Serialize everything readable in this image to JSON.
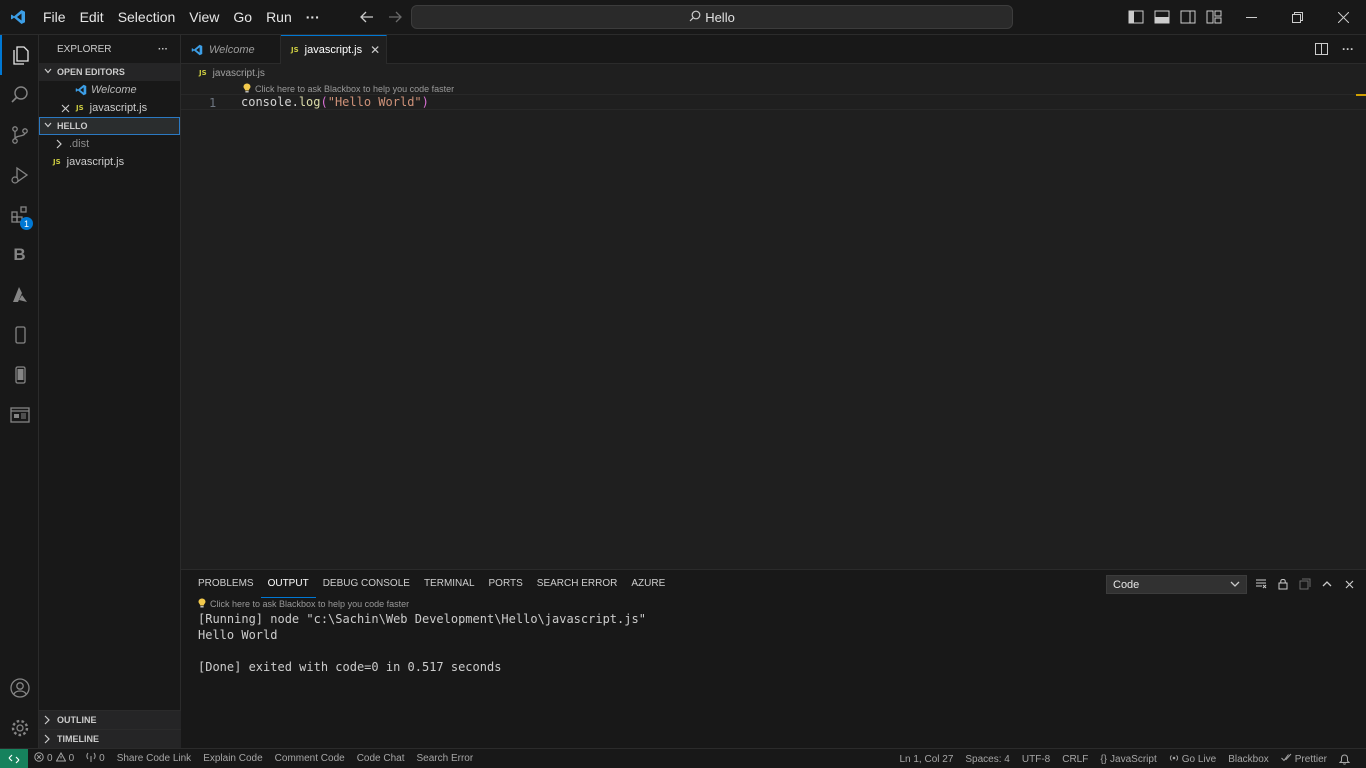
{
  "menu": {
    "items": [
      "File",
      "Edit",
      "Selection",
      "View",
      "Go",
      "Run"
    ],
    "more": "···"
  },
  "command_center": {
    "text": "Hello"
  },
  "sidebar": {
    "title": "EXPLORER",
    "more": "···",
    "open_editors_label": "OPEN EDITORS",
    "open_editors": [
      {
        "name": "Welcome"
      },
      {
        "name": "javascript.js",
        "badge": "JS"
      }
    ],
    "folder_label": "HELLO",
    "folder_items": [
      {
        "name": ".dist"
      },
      {
        "name": "javascript.js",
        "badge": "JS"
      }
    ],
    "outline_label": "OUTLINE",
    "timeline_label": "TIMELINE"
  },
  "activity": {
    "extensions_badge": "1",
    "blackbox_letter": "B"
  },
  "tabs": [
    {
      "label": "Welcome"
    },
    {
      "label": "javascript.js",
      "badge": "JS"
    }
  ],
  "breadcrumb": {
    "badge": "JS",
    "file": "javascript.js"
  },
  "editor": {
    "codelens": "Click here to ask Blackbox to help you code faster",
    "line_number": "1",
    "code": {
      "obj": "console",
      "dot": ".",
      "fn": "log",
      "open": "(",
      "str": "\"Hello World\"",
      "close": ")"
    }
  },
  "panel": {
    "tabs": [
      "PROBLEMS",
      "OUTPUT",
      "DEBUG CONSOLE",
      "TERMINAL",
      "PORTS",
      "SEARCH ERROR",
      "AZURE"
    ],
    "active_tab": "OUTPUT",
    "select_value": "Code",
    "hint": "Click here to ask Blackbox to help you code faster",
    "output_lines": [
      "[Running] node \"c:\\Sachin\\Web Development\\Hello\\javascript.js\"",
      "Hello World",
      "",
      "[Done] exited with code=0 in 0.517 seconds"
    ]
  },
  "status": {
    "errors": "0",
    "warnings": "0",
    "ports": "0",
    "left_items": [
      "Share Code Link",
      "Explain Code",
      "Comment Code",
      "Code Chat",
      "Search Error"
    ],
    "position": "Ln 1, Col 27",
    "spaces": "Spaces: 4",
    "encoding": "UTF-8",
    "eol": "CRLF",
    "language": "JavaScript",
    "go_live": "Go Live",
    "blackbox": "Blackbox",
    "prettier": "Prettier"
  },
  "colors": {
    "accent": "#0078d4",
    "remote": "#16825d",
    "js_icon": "#cbcb41"
  }
}
